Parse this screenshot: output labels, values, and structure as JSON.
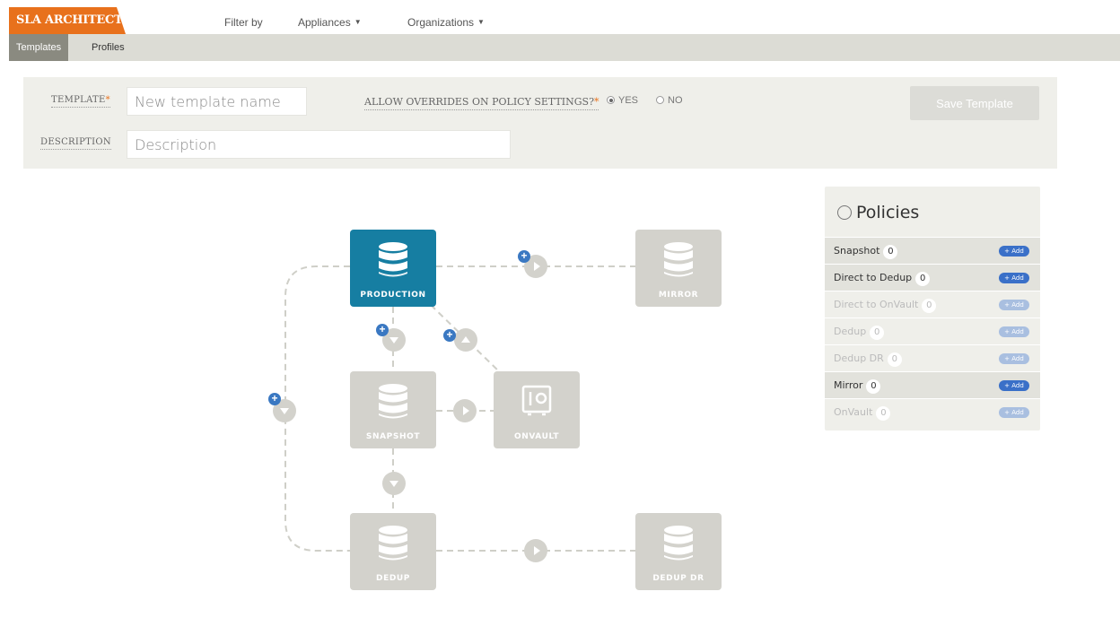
{
  "app": {
    "brand": "SLA ARCHITECT"
  },
  "topbar": {
    "filter_label": "Filter by",
    "menus": [
      {
        "label": "Appliances"
      },
      {
        "label": "Organizations"
      }
    ]
  },
  "tabs": [
    {
      "label": "Templates",
      "active": true
    },
    {
      "label": "Profiles",
      "active": false
    }
  ],
  "form": {
    "template_label": "TEMPLATE",
    "required_mark": "*",
    "template_placeholder": "New template name",
    "description_label": "DESCRIPTION",
    "description_placeholder": "Description",
    "overrides_label": "ALLOW OVERRIDES ON POLICY SETTINGS?",
    "yes_label": "YES",
    "no_label": "NO",
    "overrides_value": "YES",
    "save_label": "Save Template"
  },
  "workflow": {
    "nodes": [
      {
        "key": "production",
        "label": "PRODUCTION",
        "active": true
      },
      {
        "key": "mirror",
        "label": "MIRROR",
        "active": false
      },
      {
        "key": "snapshot",
        "label": "SNAPSHOT",
        "active": false
      },
      {
        "key": "onvault",
        "label": "ONVAULT",
        "active": false
      },
      {
        "key": "dedup",
        "label": "DEDUP",
        "active": false
      },
      {
        "key": "dedup_dr",
        "label": "DEDUP DR",
        "active": false
      }
    ],
    "plus_glyph": "+"
  },
  "policies": {
    "title": "Policies",
    "add_label": "+ Add",
    "items": [
      {
        "label": "Snapshot",
        "count": "0",
        "enabled": true
      },
      {
        "label": "Direct to Dedup",
        "count": "0",
        "enabled": true
      },
      {
        "label": "Direct to OnVault",
        "count": "0",
        "enabled": false
      },
      {
        "label": "Dedup",
        "count": "0",
        "enabled": false
      },
      {
        "label": "Dedup DR",
        "count": "0",
        "enabled": false
      },
      {
        "label": "Mirror",
        "count": "0",
        "enabled": true
      },
      {
        "label": "OnVault",
        "count": "0",
        "enabled": false
      }
    ]
  },
  "colors": {
    "brand": "#e8711c",
    "active_node": "#167ea2",
    "inactive_node": "#d3d2cc",
    "add_button": "#3a70c8"
  },
  "icons": {
    "node_icon": "database-icon",
    "vault_icon": "vault-icon",
    "connector_play": "play-icon",
    "connector_down": "chevron-down-icon"
  }
}
